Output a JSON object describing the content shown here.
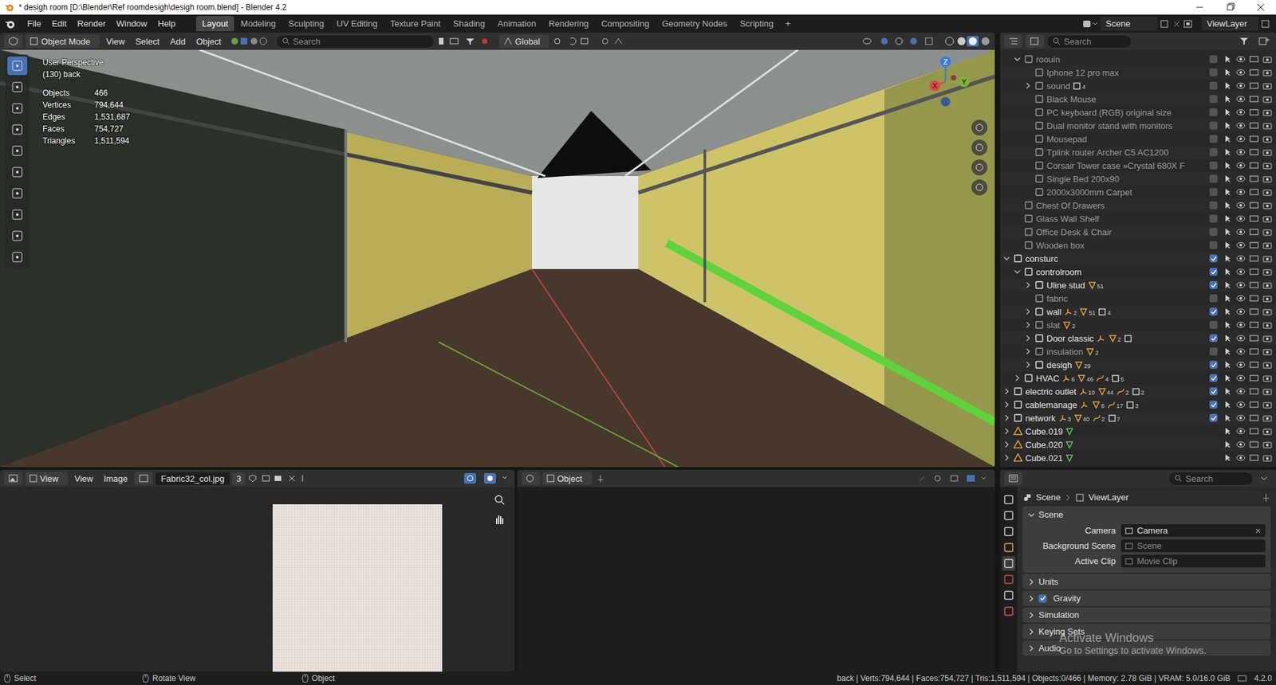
{
  "window": {
    "title": "* desigh room [D:\\Blender\\Ref roomdesigh\\desigh room.blend] - Blender 4.2"
  },
  "menu": [
    "File",
    "Edit",
    "Render",
    "Window",
    "Help"
  ],
  "workspaces": [
    {
      "label": "Layout",
      "selected": true
    },
    {
      "label": "Modeling",
      "selected": false
    },
    {
      "label": "Sculpting",
      "selected": false
    },
    {
      "label": "UV Editing",
      "selected": false
    },
    {
      "label": "Texture Paint",
      "selected": false
    },
    {
      "label": "Shading",
      "selected": false
    },
    {
      "label": "Animation",
      "selected": false
    },
    {
      "label": "Rendering",
      "selected": false
    },
    {
      "label": "Compositing",
      "selected": false
    },
    {
      "label": "Geometry Nodes",
      "selected": false
    },
    {
      "label": "Scripting",
      "selected": false
    }
  ],
  "add_workspace": "+",
  "scene": "Scene",
  "view_layer": "ViewLayer",
  "viewport": {
    "mode": "Object Mode",
    "menus": [
      "View",
      "Select",
      "Add",
      "Object"
    ],
    "search": "Search",
    "orientation": "Global",
    "view_name": "User Perspective",
    "frame_info": "(130) back",
    "stats": [
      {
        "label": "Objects",
        "value": "466"
      },
      {
        "label": "Vertices",
        "value": "794,644"
      },
      {
        "label": "Edges",
        "value": "1,531,687"
      },
      {
        "label": "Faces",
        "value": "754,727"
      },
      {
        "label": "Triangles",
        "value": "1,511,594"
      }
    ],
    "gizmo": {
      "x": "X",
      "y": "Y",
      "z": "Z"
    }
  },
  "outliner": {
    "search": "Search",
    "rows": [
      {
        "name": "roouin",
        "depth": 1,
        "arrow": "open",
        "kind": "collection",
        "checked": false,
        "badges": []
      },
      {
        "name": "Iphone 12 pro max",
        "depth": 2,
        "arrow": "none",
        "kind": "collection",
        "checked": false,
        "badges": []
      },
      {
        "name": "sound",
        "depth": 2,
        "arrow": "closed",
        "kind": "collection",
        "checked": false,
        "badges": [
          {
            "icon": "collection",
            "count": "4"
          }
        ]
      },
      {
        "name": "Black Mouse",
        "depth": 2,
        "arrow": "none",
        "kind": "collection",
        "checked": false,
        "badges": []
      },
      {
        "name": "PC keyboard (RGB) original size",
        "depth": 2,
        "arrow": "none",
        "kind": "collection",
        "checked": false,
        "badges": []
      },
      {
        "name": "Dual monitor stand with monitors",
        "depth": 2,
        "arrow": "none",
        "kind": "collection",
        "checked": false,
        "badges": []
      },
      {
        "name": "Mousepad",
        "depth": 2,
        "arrow": "none",
        "kind": "collection",
        "checked": false,
        "badges": []
      },
      {
        "name": "Tplink router Archer C5 AC1200",
        "depth": 2,
        "arrow": "none",
        "kind": "collection",
        "checked": false,
        "badges": []
      },
      {
        "name": "Corsair Tower case »Crystal 680X F",
        "depth": 2,
        "arrow": "none",
        "kind": "collection",
        "checked": false,
        "badges": []
      },
      {
        "name": "Single Bed 200x90",
        "depth": 2,
        "arrow": "none",
        "kind": "collection",
        "checked": false,
        "badges": []
      },
      {
        "name": "2000x3000mm Carpet",
        "depth": 2,
        "arrow": "none",
        "kind": "collection",
        "checked": false,
        "badges": []
      },
      {
        "name": "Chest Of Drawers",
        "depth": 1,
        "arrow": "none",
        "kind": "collection",
        "checked": false,
        "badges": []
      },
      {
        "name": "Glass Wall Shelf",
        "depth": 1,
        "arrow": "none",
        "kind": "collection",
        "checked": false,
        "badges": []
      },
      {
        "name": "Office Desk & Chair",
        "depth": 1,
        "arrow": "none",
        "kind": "collection",
        "checked": false,
        "badges": []
      },
      {
        "name": "Wooden box",
        "depth": 1,
        "arrow": "none",
        "kind": "collection",
        "checked": false,
        "badges": []
      },
      {
        "name": "consturc",
        "depth": 0,
        "arrow": "open",
        "kind": "collection",
        "checked": true,
        "badges": []
      },
      {
        "name": "controlroom",
        "depth": 1,
        "arrow": "open",
        "kind": "collection",
        "checked": true,
        "badges": []
      },
      {
        "name": "Uline stud",
        "depth": 2,
        "arrow": "closed",
        "kind": "collection",
        "checked": true,
        "badges": [
          {
            "icon": "mesh",
            "count": "51"
          }
        ]
      },
      {
        "name": "fabric",
        "depth": 2,
        "arrow": "none",
        "kind": "collection",
        "checked": false,
        "badges": []
      },
      {
        "name": "wall",
        "depth": 2,
        "arrow": "closed",
        "kind": "collection",
        "checked": true,
        "badges": [
          {
            "icon": "empty",
            "count": "2"
          },
          {
            "icon": "mesh",
            "count": "51"
          },
          {
            "icon": "collection",
            "count": "4"
          }
        ]
      },
      {
        "name": "slat",
        "depth": 2,
        "arrow": "closed",
        "kind": "collection",
        "checked": false,
        "badges": [
          {
            "icon": "mesh",
            "count": "2"
          }
        ]
      },
      {
        "name": "Door classic",
        "depth": 2,
        "arrow": "closed",
        "kind": "collection",
        "checked": true,
        "badges": [
          {
            "icon": "empty",
            "count": ""
          },
          {
            "icon": "mesh",
            "count": "2"
          },
          {
            "icon": "collection",
            "count": ""
          }
        ]
      },
      {
        "name": "insulation",
        "depth": 2,
        "arrow": "closed",
        "kind": "collection",
        "checked": false,
        "badges": [
          {
            "icon": "mesh",
            "count": "2"
          }
        ]
      },
      {
        "name": "desigh",
        "depth": 2,
        "arrow": "closed",
        "kind": "collection",
        "checked": true,
        "badges": [
          {
            "icon": "mesh",
            "count": "29"
          }
        ]
      },
      {
        "name": "HVAC",
        "depth": 1,
        "arrow": "closed",
        "kind": "collection",
        "checked": true,
        "badges": [
          {
            "icon": "empty",
            "count": "6"
          },
          {
            "icon": "mesh",
            "count": "46"
          },
          {
            "icon": "curve",
            "count": "4"
          },
          {
            "icon": "collection",
            "count": "5"
          }
        ]
      },
      {
        "name": "electric outlet",
        "depth": 0,
        "arrow": "closed",
        "kind": "collection",
        "checked": true,
        "badges": [
          {
            "icon": "empty",
            "count": "10"
          },
          {
            "icon": "mesh",
            "count": "44"
          },
          {
            "icon": "curve",
            "count": "2"
          },
          {
            "icon": "collection",
            "count": "2"
          }
        ]
      },
      {
        "name": "cablemanage",
        "depth": 0,
        "arrow": "closed",
        "kind": "collection",
        "checked": true,
        "badges": [
          {
            "icon": "empty",
            "count": ""
          },
          {
            "icon": "mesh",
            "count": "8"
          },
          {
            "icon": "curve",
            "count": "17"
          },
          {
            "icon": "collection",
            "count": "3"
          }
        ]
      },
      {
        "name": "network",
        "depth": 0,
        "arrow": "closed",
        "kind": "collection",
        "checked": true,
        "badges": [
          {
            "icon": "empty",
            "count": "3"
          },
          {
            "icon": "mesh",
            "count": "40"
          },
          {
            "icon": "curve",
            "count": "2"
          },
          {
            "icon": "collection",
            "count": "7"
          }
        ]
      },
      {
        "name": "Cube.019",
        "depth": 0,
        "arrow": "closed",
        "kind": "object",
        "checked": true,
        "badges": [
          {
            "icon": "meshdata",
            "count": ""
          }
        ]
      },
      {
        "name": "Cube.020",
        "depth": 0,
        "arrow": "closed",
        "kind": "object",
        "checked": true,
        "badges": [
          {
            "icon": "meshdata",
            "count": ""
          }
        ]
      },
      {
        "name": "Cube.021",
        "depth": 0,
        "arrow": "closed",
        "kind": "object",
        "checked": true,
        "badges": [
          {
            "icon": "meshdata",
            "count": ""
          }
        ]
      }
    ]
  },
  "image_editor": {
    "menus": [
      "View",
      "View",
      "Image"
    ],
    "image_name": "Fabric32_col.jpg",
    "users": "3"
  },
  "node_editor": {
    "context": "Object"
  },
  "properties": {
    "search": "Search",
    "breadcrumb": [
      "Scene",
      "ViewLayer"
    ],
    "panel": "Scene",
    "fields": [
      {
        "label": "Camera",
        "value": "Camera",
        "placeholder": false
      },
      {
        "label": "Background Scene",
        "value": "Scene",
        "placeholder": true
      },
      {
        "label": "Active Clip",
        "value": "Movie Clip",
        "placeholder": true
      }
    ],
    "subpanels": [
      {
        "label": "Units",
        "kind": "plain",
        "checked": false
      },
      {
        "label": "Gravity",
        "kind": "checkbox",
        "checked": true
      },
      {
        "label": "Simulation",
        "kind": "plain",
        "checked": false
      },
      {
        "label": "Keying Sets",
        "kind": "plain",
        "checked": false
      },
      {
        "label": "Audio",
        "kind": "plain",
        "checked": false
      }
    ]
  },
  "watermark": {
    "title": "Activate Windows",
    "subtitle": "Go to Settings to activate Windows."
  },
  "status_bar": {
    "hints": [
      "Select",
      "Rotate View",
      "Object"
    ],
    "info": "back | Verts:794,644 | Faces:754,727 | Tris:1,511,594 | Objects:0/466 | Memory: 2.78 GiB | VRAM: 5.0/16.0 GiB",
    "version": "4.2.0"
  }
}
